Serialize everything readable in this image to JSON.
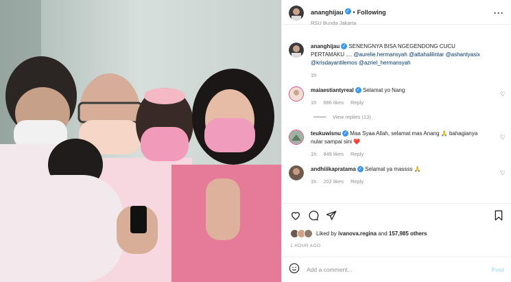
{
  "post": {
    "username": "ananghijau",
    "follow_status": "Following",
    "location": "RSU Bunda Jakarta",
    "caption_text": "SENENGNYA BISA NGEGENDONG CUCU PERTAMAKU ....",
    "caption_mentions": "@aurelie.hermansyah @attahalilintar @ashantyasix @krisdayantilemos @azriel_hermansyah",
    "caption_time": "1h"
  },
  "comments": [
    {
      "user": "maiaestiantyreal",
      "text": "Selamat yo Nang",
      "time": "1h",
      "likes": "686 likes",
      "reply": "Reply",
      "view_replies": "View replies (13)"
    },
    {
      "user": "teukuwisnu",
      "text": "Maa Syaa Allah, selamat mas Anang 🙏 bahagianya nular sampai sini ❤️",
      "time": "1h",
      "likes": "849 likes",
      "reply": "Reply"
    },
    {
      "user": "andhiiikapratama",
      "text": "Selamat ya massss 🙏",
      "time": "1h",
      "likes": "202 likes",
      "reply": "Reply"
    }
  ],
  "likes_line": {
    "prefix": "Liked by",
    "user": "ivanova.regina",
    "and": "and",
    "count": "157,985 others"
  },
  "timestamp": "1 HOUR AGO",
  "add_comment": {
    "placeholder": "Add a comment...",
    "post": "Post"
  },
  "icons": {
    "emoji": "smiley-icon",
    "heart": "heart-icon",
    "comment": "comment-icon",
    "share": "share-icon",
    "save": "bookmark-icon",
    "more": "more-icon"
  },
  "colors": {
    "link": "#00376b",
    "verified": "#3897f0",
    "muted": "#8e8e8e",
    "heart_red": "#ed4956"
  }
}
